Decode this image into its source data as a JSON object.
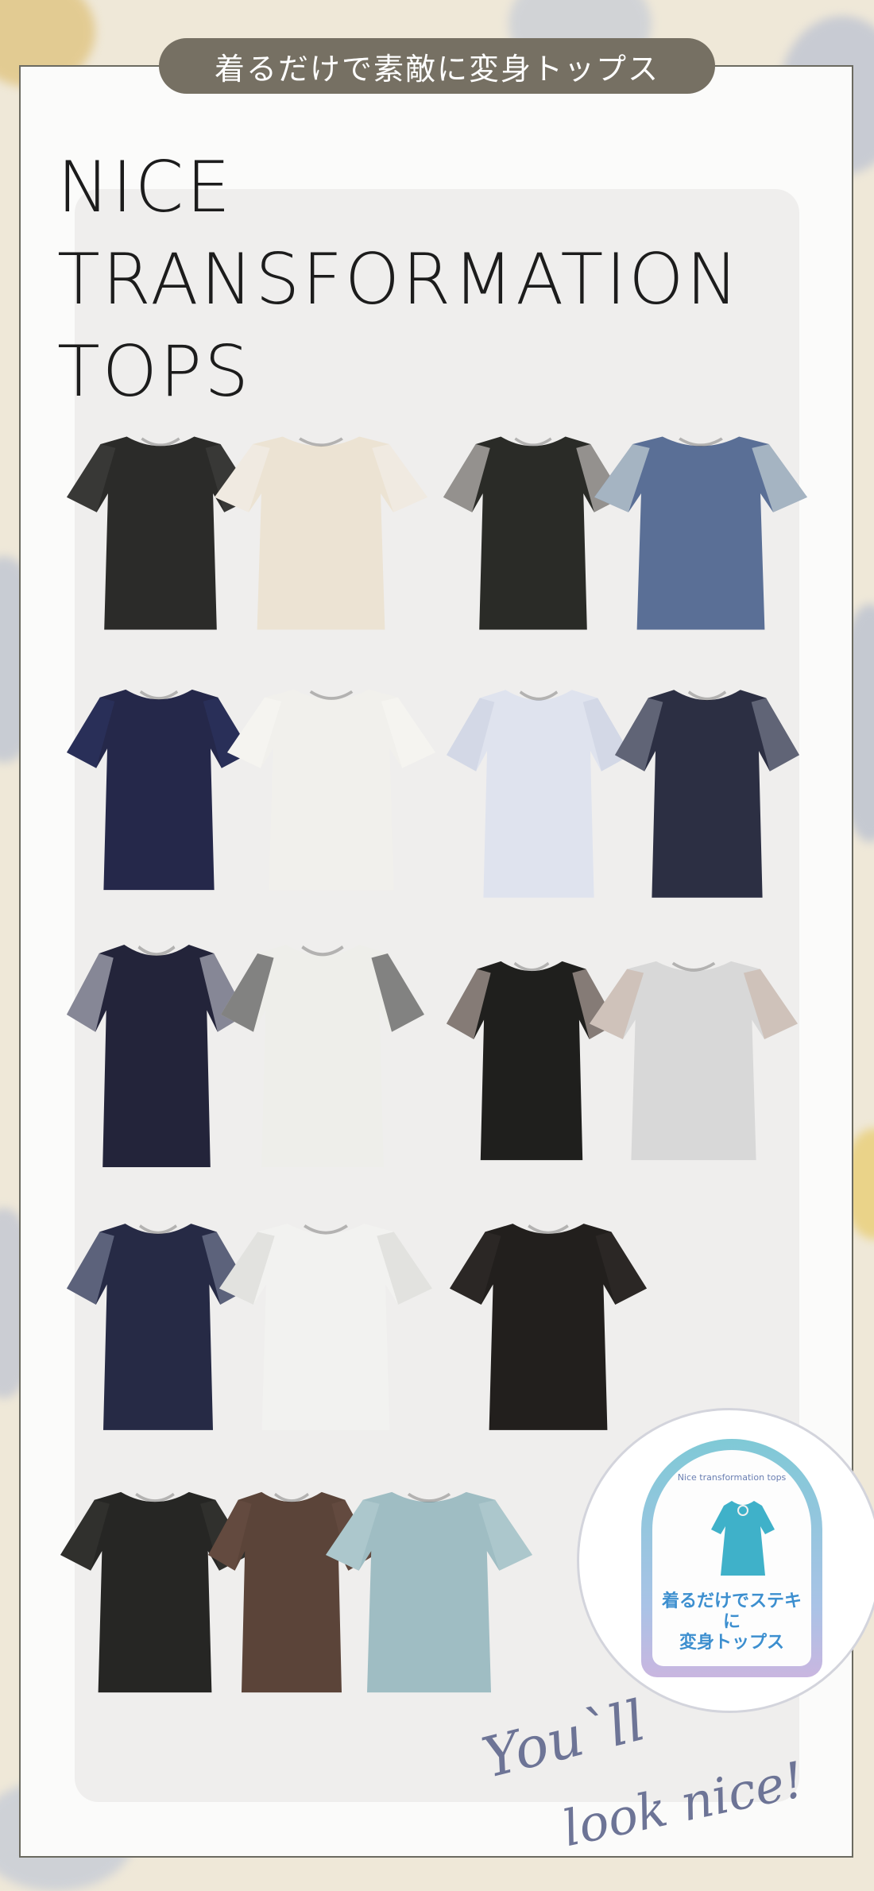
{
  "header": {
    "tagline": "着るだけで素敵に変身トップス"
  },
  "hero": {
    "title_lines": [
      "NICE",
      "TRANSFORMATION",
      "TOPS"
    ]
  },
  "badge": {
    "arc_text": "Nice transformation tops",
    "jp_line1": "着るだけでステキに",
    "jp_line2": "変身トップス"
  },
  "script": {
    "line1": "You`ll",
    "line2": "look nice!"
  },
  "products": [
    {
      "name": "black-flutter-sleeve-top",
      "color": "#2b2b29",
      "accent": "#444442"
    },
    {
      "name": "cream-dot-sleeve-top",
      "color": "#ece3d3",
      "accent": "#f4f1ec"
    },
    {
      "name": "black-layered-hem-tee",
      "color": "#2a2b27",
      "accent": "#ebe6e3"
    },
    {
      "name": "blue-layered-hem-tee",
      "color": "#5a6f96",
      "accent": "#e4ece8"
    },
    {
      "name": "navy-lace-yoke-top",
      "color": "#25284a",
      "accent": "#2e3565"
    },
    {
      "name": "white-lace-yoke-top",
      "color": "#f1f0ec",
      "accent": "#f7f7f4"
    },
    {
      "name": "blue-stripe-blouse",
      "color": "#dfe3ee",
      "accent": "#c9cfe0"
    },
    {
      "name": "navy-stripe-blouse",
      "color": "#2c2f43",
      "accent": "#8d90a0"
    },
    {
      "name": "navy-print-tunic",
      "color": "#23243a",
      "accent": "#d8d8e2"
    },
    {
      "name": "white-dot-tunic",
      "color": "#eeeeea",
      "accent": "#2a2a2a"
    },
    {
      "name": "black-check-side-tee",
      "color": "#1f1f1d",
      "accent": "#d8c6c0"
    },
    {
      "name": "gray-check-side-tee",
      "color": "#d8d8d8",
      "accent": "#c9b0a2"
    },
    {
      "name": "navy-stripe-vneck",
      "color": "#262a45",
      "accent": "#8890a8"
    },
    {
      "name": "white-stripe-vneck",
      "color": "#f2f2f0",
      "accent": "#d5d5d2"
    },
    {
      "name": "black-gather-tunic",
      "color": "#221f1d",
      "accent": "#332e2b"
    },
    {
      "name": "black-tie-sleeve-top",
      "color": "#262624",
      "accent": "#383835"
    },
    {
      "name": "brown-tie-sleeve-top",
      "color": "#5b4439",
      "accent": "#6a5045"
    },
    {
      "name": "mint-tie-sleeve-top",
      "color": "#9fbdc3",
      "accent": "#b6d0d4"
    }
  ]
}
